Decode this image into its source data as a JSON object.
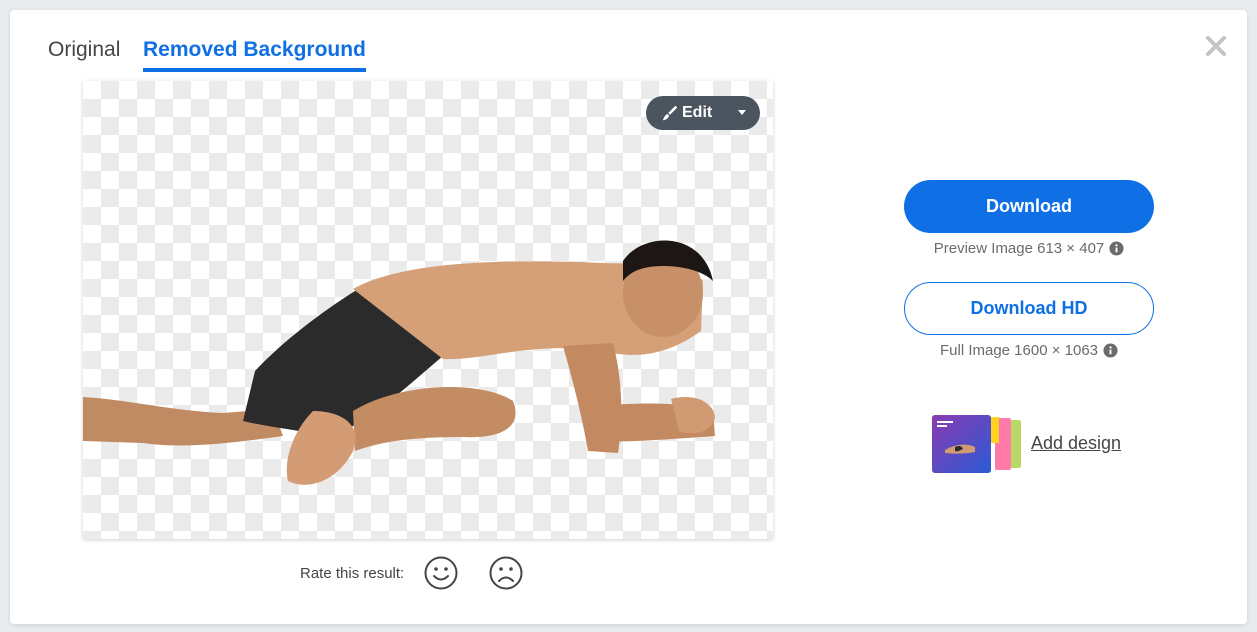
{
  "tabs": [
    {
      "label": "Original",
      "active": false
    },
    {
      "label": "Removed Background",
      "active": true
    }
  ],
  "close": {
    "icon": "close-icon"
  },
  "image": {
    "description": "subject with background removed"
  },
  "edit": {
    "label": "Edit",
    "icon": "brush-icon",
    "dropdown_icon": "caret-down-icon"
  },
  "rate": {
    "label": "Rate this result:",
    "positive_icon": "smiley-icon",
    "negative_icon": "frown-icon"
  },
  "download": {
    "label": "Download",
    "preview_text": "Preview Image 613 × 407"
  },
  "download_hd": {
    "label": "Download HD",
    "full_text": "Full Image 1600 × 1063"
  },
  "add_design": {
    "label": "Add design"
  },
  "colors": {
    "accent": "#0f70e6",
    "edit_bg": "#4b5560",
    "text": "#454545",
    "muted": "#6b6b6b"
  }
}
